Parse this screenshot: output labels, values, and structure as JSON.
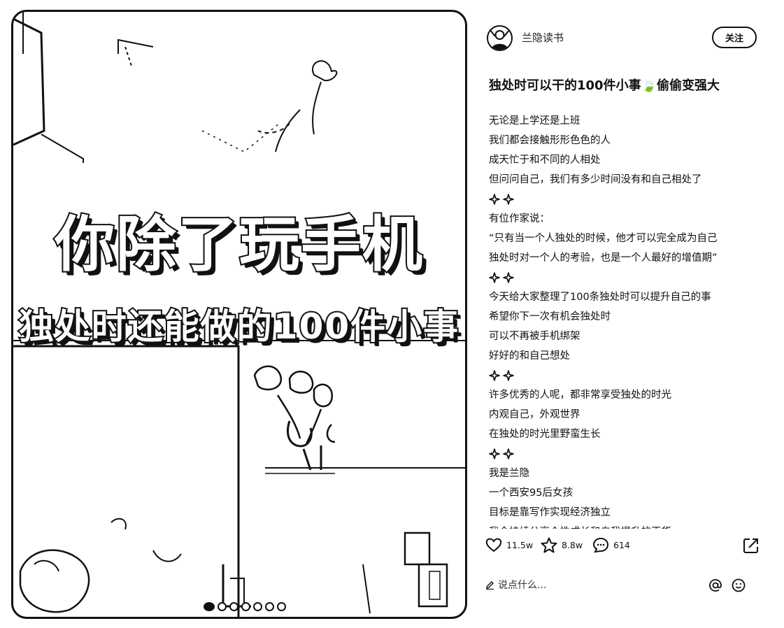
{
  "author": {
    "name": "兰隐读书"
  },
  "follow_button": {
    "label": "关注"
  },
  "post": {
    "title": "独处时可以干的100件小事🍃偷偷变强大",
    "lines": [
      "无论是上学还是上班",
      "我们都会接触形形色色的人",
      "成天忙于和不同的人相处",
      "但问问自己，我们有多少时间没有和自己相处了",
      "",
      "有位作家说：",
      "“只有当一个人独处的时候，他才可以完全成为自己",
      "独处时对一个人的考验，也是一个人最好的增值期”",
      "",
      "今天给大家整理了100条独处时可以提升自己的事",
      "希望你下一次有机会独处时",
      "可以不再被手机绑架",
      "好好的和自己想处",
      "",
      "许多优秀的人呢，都非常享受独处的时光",
      "内观自己，外观世界",
      "在独处的时光里野蛮生长",
      "",
      "我是兰隐",
      "一个西安95后女孩",
      "目标是靠写作实现经济独立",
      "我会持续分享个性成长和自我提升的干货"
    ]
  },
  "image": {
    "headline_1": "你除了玩手机",
    "headline_2": "独处时还能做的100件小事",
    "carousel": {
      "total": 7,
      "active_index": 0
    }
  },
  "actions": {
    "likes": "11.5w",
    "collects": "8.8w",
    "comments": "614"
  },
  "comment_box": {
    "placeholder": "说点什么..."
  },
  "icons": {
    "like": "heart-icon",
    "collect": "star-icon",
    "comment": "comment-bubble-icon",
    "share": "share-icon",
    "compose": "pencil-icon",
    "mention": "at-sign-icon",
    "emoji": "emoji-smile-icon",
    "sparkle": "sparkle-icon"
  }
}
